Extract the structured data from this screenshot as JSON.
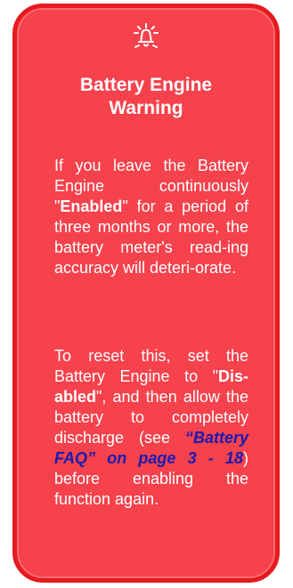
{
  "note": {
    "icon": "bell-icon",
    "title_line1": "Battery Engine",
    "title_line2": "Warning",
    "p1": {
      "t1": "If you leave the Battery Engine continuously \"",
      "bold": "Enabled",
      "t2": "\" for a period of three months or more, the battery meter's read-ing accuracy will deteri-orate."
    },
    "p2": {
      "t1": "To reset this, set the Battery Engine to \"",
      "bold": "Dis-abled",
      "t2": "\", and then allow the battery to completely discharge (see ",
      "link": "“Battery FAQ” on page 3 - 18",
      "t3": ") before enabling the function again."
    }
  },
  "colors": {
    "background": "#f5424c",
    "border": "#e61a1e",
    "text": "#ffffff",
    "link": "#1a1ab3"
  }
}
